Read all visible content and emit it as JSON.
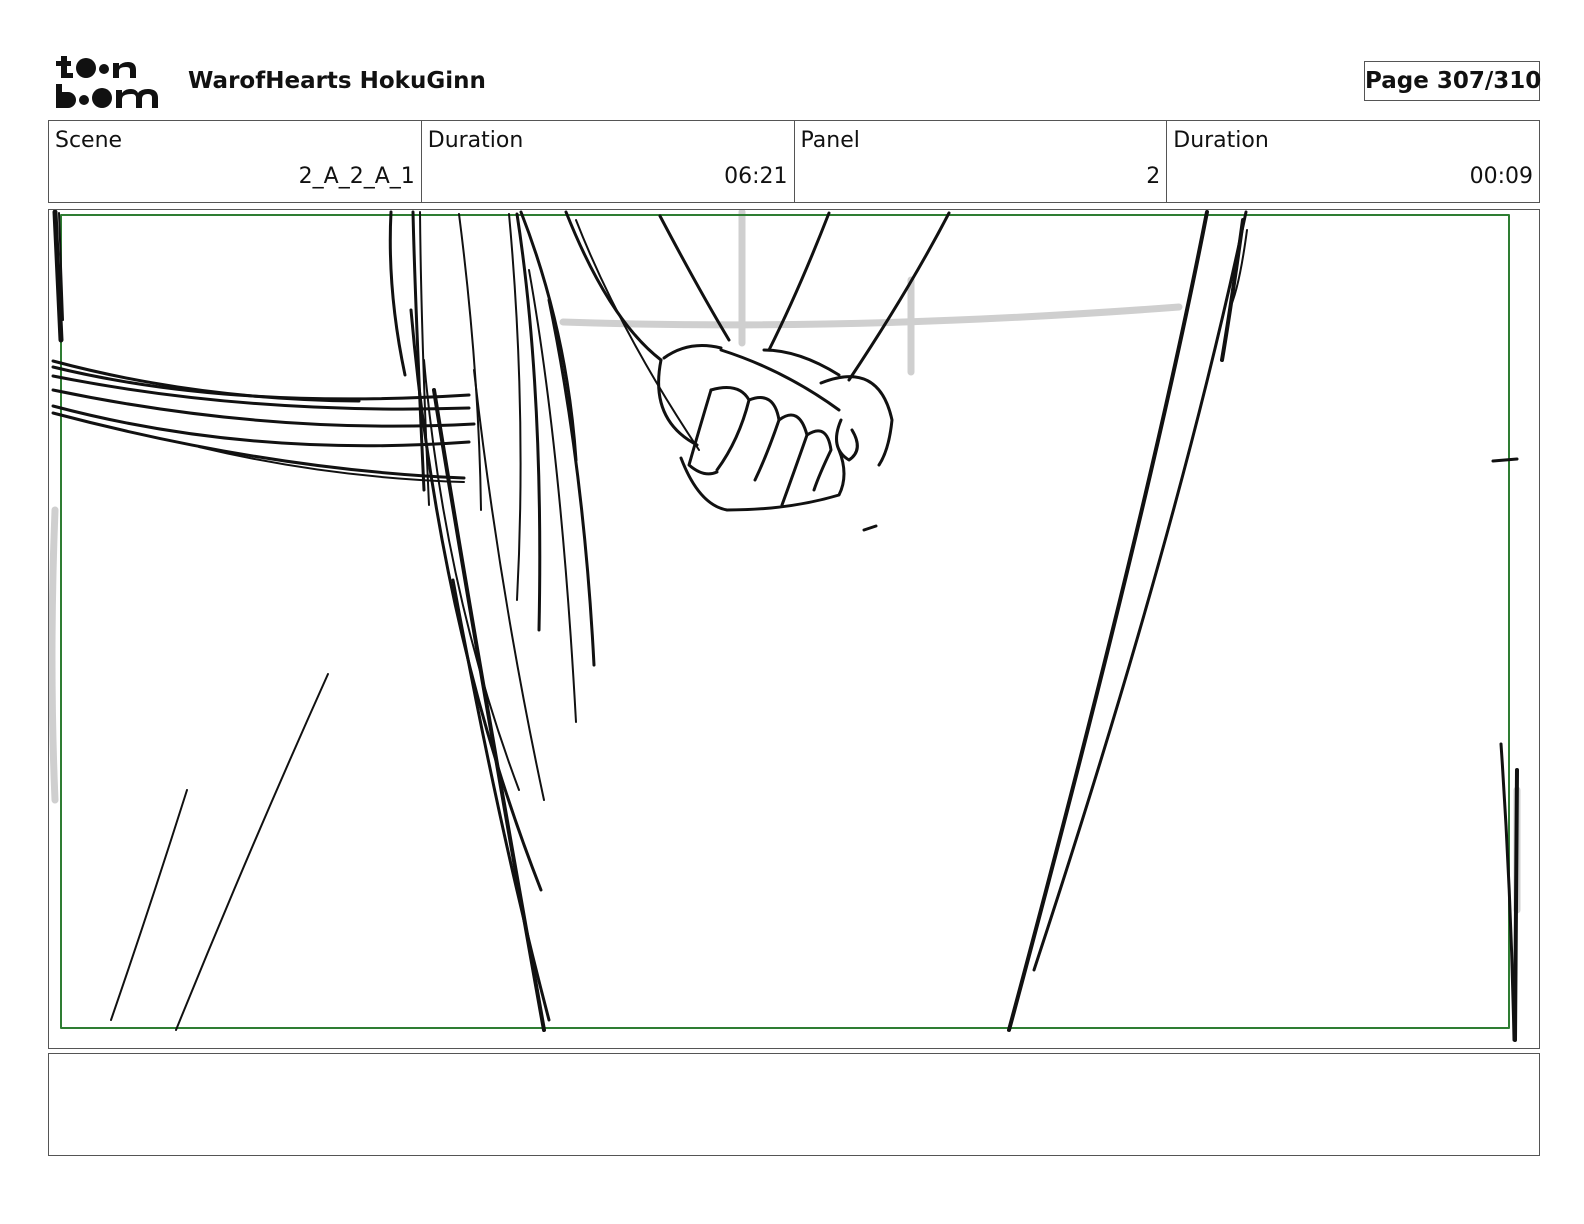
{
  "header": {
    "logo_icon": "toonboom-logo",
    "logo_text": "toonboom",
    "project_title": "WarofHearts HokuGinn",
    "page_label": "Page 307/310"
  },
  "info": {
    "scene": {
      "label": "Scene",
      "value": "2_A_2_A_1"
    },
    "scene_duration": {
      "label": "Duration",
      "value": "06:21"
    },
    "panel": {
      "label": "Panel",
      "value": "2"
    },
    "panel_duration": {
      "label": "Duration",
      "value": "00:09"
    }
  },
  "panel_image": {
    "subject": "storyboard-sketch-holding-hands",
    "safe_frame_color": "#2e7d32",
    "line_color": "#111111",
    "guide_color": "#cfcfcf"
  },
  "notes": {
    "text": ""
  }
}
